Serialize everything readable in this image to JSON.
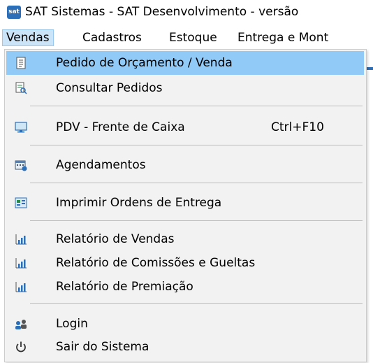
{
  "window": {
    "app_icon_text": "sat",
    "title": "SAT Sistemas - SAT Desenvolvimento - versão"
  },
  "menubar": {
    "items": [
      {
        "label": "Vendas",
        "active": true
      },
      {
        "label": "Cadastros"
      },
      {
        "label": "Estoque"
      },
      {
        "label": "Entrega e Mont"
      }
    ]
  },
  "menu": {
    "items": [
      {
        "label": "Pedido de Orçamento / Venda",
        "icon": "order-form-icon",
        "highlighted": true
      },
      {
        "label": "Consultar Pedidos",
        "icon": "search-orders-icon"
      },
      {
        "label": "PDV - Frente de Caixa",
        "shortcut": "Ctrl+F10",
        "icon": "monitor-icon"
      },
      {
        "label": "Agendamentos",
        "icon": "calendar-icon"
      },
      {
        "label": "Imprimir Ordens de Entrega",
        "icon": "print-delivery-icon"
      },
      {
        "label": "Relatório de Vendas",
        "icon": "bar-chart-icon"
      },
      {
        "label": "Relatório de Comissões e Gueltas",
        "icon": "bar-chart-icon"
      },
      {
        "label": "Relatório de Premiação",
        "icon": "bar-chart-icon"
      },
      {
        "label": "Login",
        "icon": "users-icon"
      },
      {
        "label": "Sair do Sistema",
        "icon": "power-icon"
      }
    ],
    "colors": {
      "highlight": "#91c9f7",
      "background": "#f2f2f2",
      "separator": "#bdbdbd"
    }
  }
}
